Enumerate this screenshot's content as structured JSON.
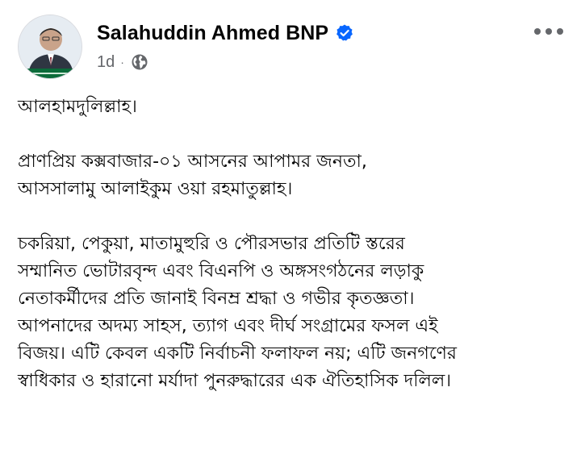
{
  "post": {
    "author": {
      "name": "Salahuddin Ahmed BNP",
      "verified": true,
      "avatar_icon": "profile-photo"
    },
    "meta": {
      "time": "1d",
      "separator": "·",
      "audience_icon": "globe-icon"
    },
    "menu_icon": "more-horizontal-icon",
    "body": {
      "paragraph_1": [
        "আলহামদুলিল্লাহ।"
      ],
      "paragraph_2": [
        "প্রাণপ্রিয় কক্সবাজার-০১ আসনের আপামর জনতা,",
        "আসসালামু আলাইকুম ওয়া রহমাতুল্লাহ।"
      ],
      "paragraph_3": [
        "চকরিয়া, পেকুয়া, মাতামুহুরি ও পৌরসভার প্রতিটি স্তরের",
        "সম্মানিত ভোটারবৃন্দ এবং বিএনপি ও অঙ্গসংগঠনের লড়াকু",
        "নেতাকর্মীদের প্রতি জানাই বিনম্র শ্রদ্ধা ও গভীর কৃতজ্ঞতা।",
        "আপনাদের অদম্য সাহস, ত্যাগ এবং দীর্ঘ সংগ্রামের ফসল এই",
        "বিজয়। এটি কেবল একটি নির্বাচনী ফলাফল নয়; এটি জনগণের",
        "স্বাধিকার ও হারানো মর্যাদা পুনরুদ্ধারের এক ঐতিহাসিক দলিল।"
      ]
    }
  },
  "colors": {
    "text": "#050505",
    "secondary_text": "#65676b",
    "verified_badge": "#0866ff",
    "background": "#ffffff",
    "avatar_banner": "#0b6b3a"
  }
}
